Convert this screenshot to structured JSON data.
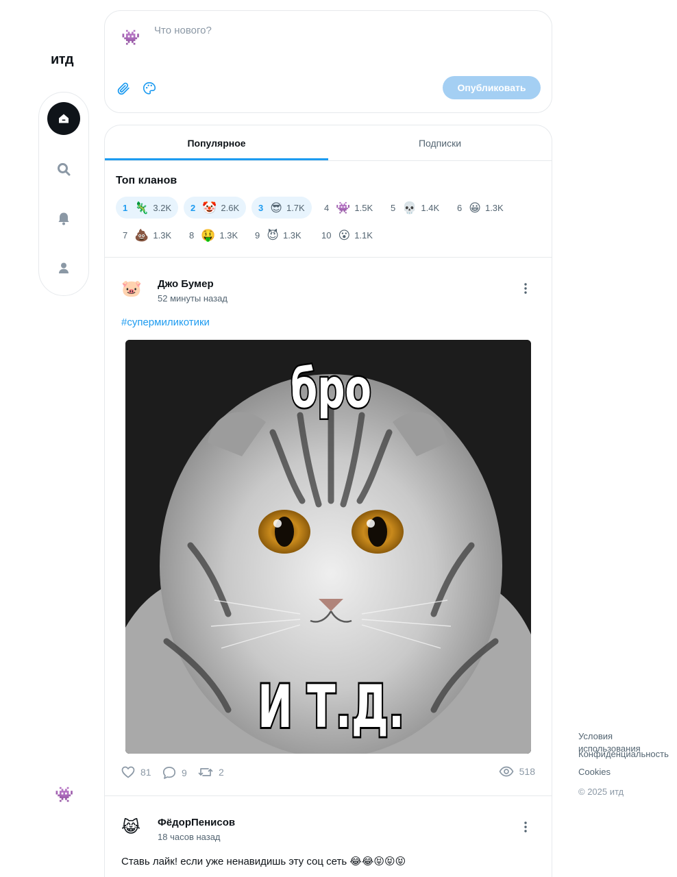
{
  "app": {
    "logo": "итд"
  },
  "nav": {
    "items": [
      {
        "name": "home",
        "icon": "home-icon",
        "active": true
      },
      {
        "name": "search",
        "icon": "search-icon",
        "active": false
      },
      {
        "name": "notifications",
        "icon": "bell-icon",
        "active": false
      },
      {
        "name": "profile",
        "icon": "user-icon",
        "active": false
      }
    ]
  },
  "current_user": {
    "avatar": "👾"
  },
  "composer": {
    "avatar": "👾",
    "placeholder": "Что нового?",
    "attach_icon": "paperclip-icon",
    "palette_icon": "palette-icon",
    "publish_label": "Опубликовать"
  },
  "tabs": [
    {
      "label": "Популярное",
      "active": true
    },
    {
      "label": "Подписки",
      "active": false
    }
  ],
  "clans": {
    "title": "Топ кланов",
    "items": [
      {
        "rank": "1",
        "emoji": "🦎",
        "count": "3.2K"
      },
      {
        "rank": "2",
        "emoji": "🤡",
        "count": "2.6K"
      },
      {
        "rank": "3",
        "emoji": "😎",
        "count": "1.7K"
      },
      {
        "rank": "4",
        "emoji": "👾",
        "count": "1.5K"
      },
      {
        "rank": "5",
        "emoji": "💀",
        "count": "1.4K"
      },
      {
        "rank": "6",
        "emoji": "😀",
        "count": "1.3K"
      },
      {
        "rank": "7",
        "emoji": "💩",
        "count": "1.3K"
      },
      {
        "rank": "8",
        "emoji": "🤑",
        "count": "1.3K"
      },
      {
        "rank": "9",
        "emoji": "😈",
        "count": "1.3K"
      },
      {
        "rank": "10",
        "emoji": "😮",
        "count": "1.1K"
      }
    ]
  },
  "posts": [
    {
      "avatar": "🐷",
      "author": "Джо Бумер",
      "time": "52 минуты назад",
      "hashtag": "#супермиликотики",
      "image": {
        "top_caption": "бро",
        "bottom_caption": "И Т.Д."
      },
      "likes": "81",
      "comments": "9",
      "reposts": "2",
      "views": "518"
    },
    {
      "avatar": "😹",
      "author": "ФёдорПенисов",
      "time": "18 часов назад",
      "text": "Ставь лайк! если уже ненавидишь эту соц сеть 😂😂😝😝😝"
    }
  ],
  "footer": {
    "links": [
      "Условия использования",
      "Конфиденциальность",
      "Cookies"
    ],
    "copyright": "© 2025 итд"
  },
  "colors": {
    "accent": "#1d9bf0",
    "publish_disabled": "#a4cff3",
    "clan_highlight": "#e8f4fd",
    "nav_active": "#0f1419"
  }
}
